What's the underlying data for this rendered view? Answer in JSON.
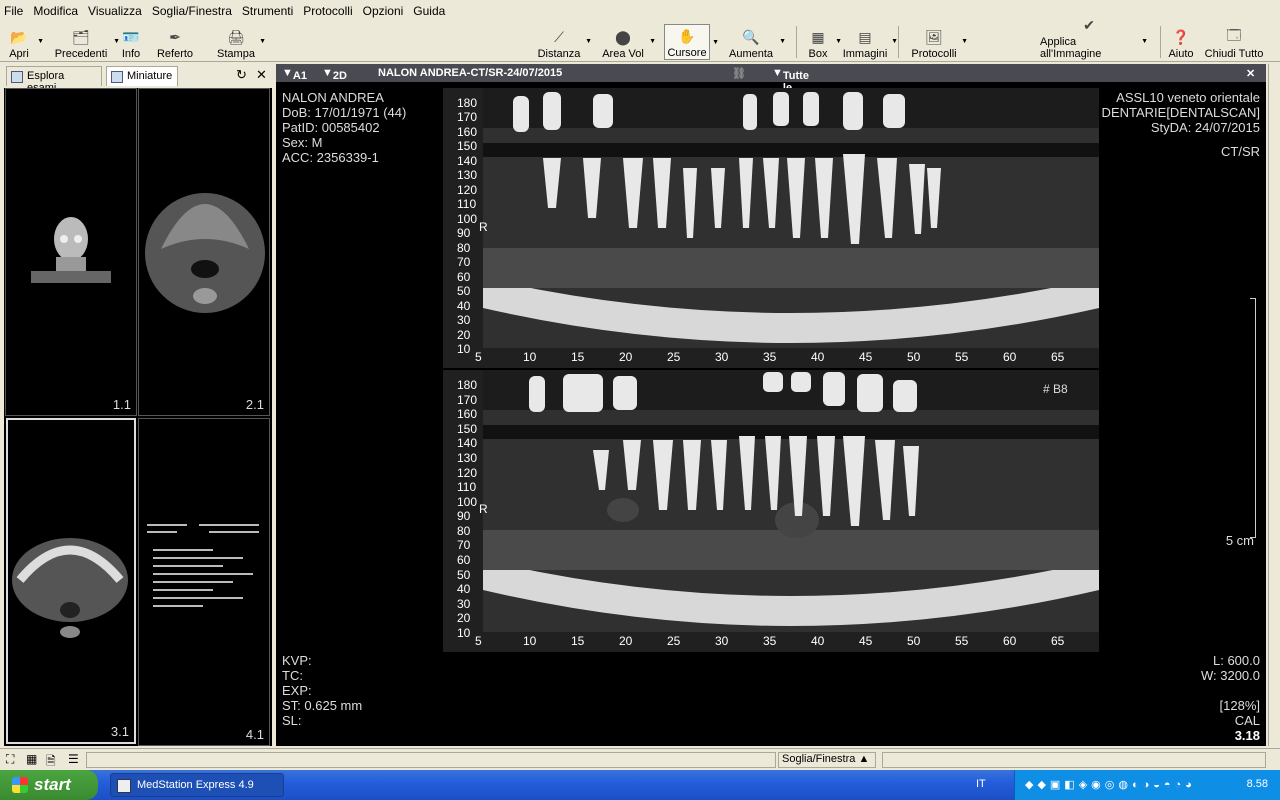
{
  "menu": [
    "File",
    "Modifica",
    "Visualizza",
    "Soglia/Finestra",
    "Strumenti",
    "Protocolli",
    "Opzioni",
    "Guida"
  ],
  "toolbar": {
    "apri": "Apri",
    "precedenti": "Precedenti",
    "info": "Info",
    "referto": "Referto",
    "stampa": "Stampa",
    "distanza": "Distanza",
    "area_vol": "Area Vol",
    "cursore": "Cursore",
    "aumenta": "Aumenta",
    "box": "Box",
    "immagini": "Immagini",
    "protocolli": "Protocolli",
    "applica": "Applica all'Immagine",
    "aiuto": "Aiuto",
    "chiudi": "Chiudi Tutto"
  },
  "left_panel": {
    "tab_esplora": "Esplora esami",
    "tab_miniature": "Miniature",
    "thumbs": [
      "1.1",
      "2.1",
      "3.1",
      "4.1"
    ]
  },
  "viewer": {
    "layout": "A1",
    "mode": "2D",
    "title": "NALON ANDREA-CT/SR-24/07/2015",
    "series": "Tutte le serie",
    "patient": {
      "name": "NALON ANDREA",
      "dob": "DoB: 17/01/1971 (44)",
      "patid": "PatID: 00585402",
      "sex": "Sex: M",
      "acc": "ACC: 2356339-1"
    },
    "institution": "ASSL10 veneto orientale",
    "study": "TC DELLE ARCATE DENTARIE[DENTALSCAN]",
    "study_date": "StyDA: 24/07/2015",
    "modality": "CT/SR",
    "tech": {
      "kvp": "KVP:",
      "tc": "TC:",
      "exp": "EXP:",
      "st": "ST: 0.625 mm",
      "sl": "SL:"
    },
    "level": "L: 600.0",
    "width": "W: 3200.0",
    "zoom": "[128%]",
    "cal_label": "CAL",
    "cal_value": "3.18",
    "scale_label": "5 cm",
    "marker_b8": "# B8",
    "marker_r": "R",
    "ruler_v": [
      "180",
      "170",
      "160",
      "150",
      "140",
      "130",
      "120",
      "110",
      "100",
      "90",
      "80",
      "70",
      "60",
      "50",
      "40",
      "30",
      "20",
      "10"
    ],
    "ruler_h": [
      "5",
      "10",
      "15",
      "20",
      "25",
      "30",
      "35",
      "40",
      "45",
      "50",
      "55",
      "60",
      "65"
    ]
  },
  "statusbar": {
    "mode": "Soglia/Finestra"
  },
  "taskbar": {
    "start": "start",
    "app": "MedStation Express 4.9",
    "lang": "IT",
    "time": "8.58"
  }
}
